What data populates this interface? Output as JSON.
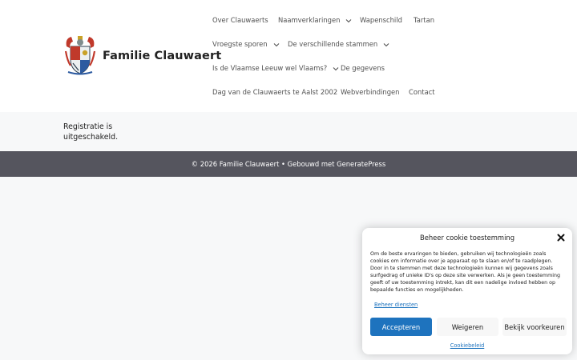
{
  "header": {
    "site_title": "Familie Clauwaert",
    "logo_icon": "family-coat-of-arms-icon"
  },
  "nav": {
    "items": [
      {
        "label": "Over Clauwaerts",
        "has_submenu": false
      },
      {
        "label": "Naamverklaringen",
        "has_submenu": true
      },
      {
        "label": "Wapenschild",
        "has_submenu": false
      },
      {
        "label": "Tartan",
        "has_submenu": false
      },
      {
        "label": "Vroegste sporen",
        "has_submenu": true
      },
      {
        "label": "De verschillende stammen",
        "has_submenu": true
      },
      {
        "label": "Is de Vlaamse Leeuw wel Vlaams?",
        "has_submenu": true
      },
      {
        "label": "De gegevens",
        "has_submenu": false
      },
      {
        "label": "Dag van de Clauwaerts te Aalst 2002",
        "has_submenu": false
      },
      {
        "label": "Webverbindingen",
        "has_submenu": false
      },
      {
        "label": "Contact",
        "has_submenu": false
      }
    ]
  },
  "main": {
    "message": "Registratie is uitgeschakeld."
  },
  "footer": {
    "copyright": "© 2026 Familie Clauwaert",
    "separator": " • ",
    "built_with": "Gebouwd met GeneratePress"
  },
  "cookie_banner": {
    "title": "Beheer cookie toestemming",
    "body": "Om de beste ervaringen te bieden, gebruiken wij technologieën zoals cookies om informatie over je apparaat op te slaan en/of te raadplegen. Door in te stemmen met deze technologieën kunnen wij gegevens zoals surfgedrag of unieke ID's op deze site verwerken. Als je geen toestemming geeft of uw toestemming intrekt, kan dit een nadelige invloed hebben op bepaalde functies en mogelijkheden.",
    "manage_services": "Beheer diensten",
    "accept_label": "Accepteren",
    "deny_label": "Weigeren",
    "preferences_label": "Bekijk voorkeuren",
    "policy_link": "Cookiebeleid"
  },
  "colors": {
    "accent": "#1e73be",
    "footer_bg": "#55555e",
    "page_bg": "#f7f8f9",
    "nav_text": "#515151"
  }
}
